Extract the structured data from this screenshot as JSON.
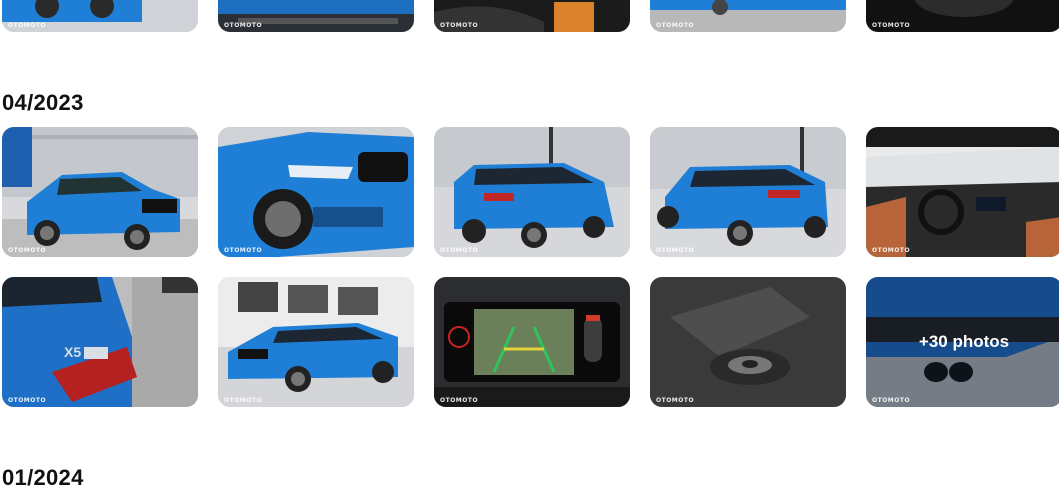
{
  "watermark": "OTOMOTO",
  "sections": [
    {
      "heading": "04/2023"
    },
    {
      "heading": "01/2024"
    }
  ],
  "more_photos_label": "+30 photos",
  "colors": {
    "car_blue": "#1f7fd6",
    "background": "#ffffff"
  }
}
